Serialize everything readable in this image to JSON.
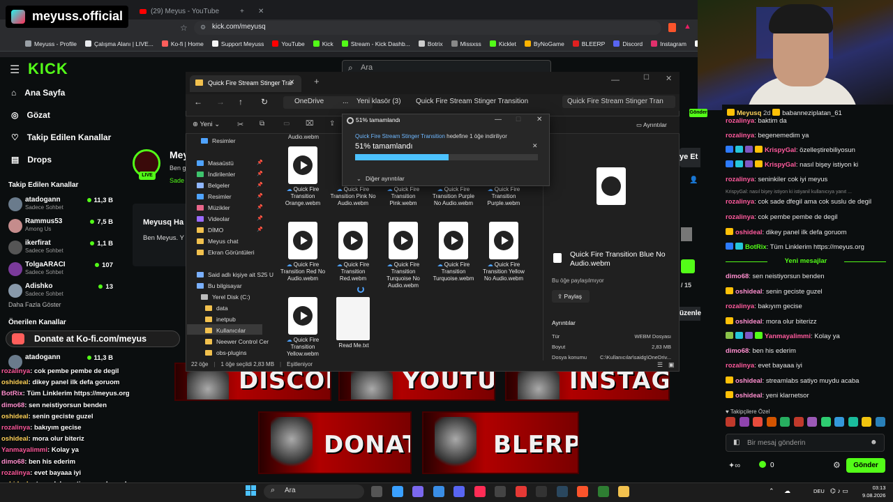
{
  "browser": {
    "tabs": [
      {
        "label": "Meyuss | Kick"
      },
      {
        "label": "(29) Meyus - YouTube"
      }
    ],
    "url": "kick.com/meyusq",
    "bookmarks": [
      {
        "label": "Meyuss - Profile",
        "color": "#9aa0a6"
      },
      {
        "label": "Çalışma Alanı | LIVE...",
        "color": "#e8eaed"
      },
      {
        "label": "Ko-fi | Home",
        "color": "#ff5e5b"
      },
      {
        "label": "Support Meyuss",
        "color": "#f5f5f5"
      },
      {
        "label": "YouTube",
        "color": "#ff0000"
      },
      {
        "label": "Kick",
        "color": "#53fc18"
      },
      {
        "label": "Stream - Kick Dashb...",
        "color": "#53fc18"
      },
      {
        "label": "Botrix",
        "color": "#cccccc"
      },
      {
        "label": "Missxss",
        "color": "#888888"
      },
      {
        "label": "Kicklet",
        "color": "#53fc18"
      },
      {
        "label": "ByNoGame",
        "color": "#ffb300"
      },
      {
        "label": "BLEERP",
        "color": "#e02020"
      },
      {
        "label": "Discord",
        "color": "#5865f2"
      },
      {
        "label": "Instagram",
        "color": "#e1306c"
      },
      {
        "label": "Tiktok",
        "color": "#ffffff"
      }
    ]
  },
  "overlay": {
    "tiktok_handle": "meyuss.official",
    "kofi_banner": "Donate at Ko-fi.com/meyus"
  },
  "kick": {
    "logo": "KICK",
    "search_placeholder": "Ara",
    "nav": [
      {
        "label": "Ana Sayfa"
      },
      {
        "label": "Gözat"
      },
      {
        "label": "Takip Edilen Kanallar"
      },
      {
        "label": "Drops"
      }
    ],
    "followed_header": "Takip Edilen Kanallar",
    "followed": [
      {
        "name": "atadogann",
        "category": "Sadece Sohbet",
        "viewers": "11,3 B",
        "color": "#6a7b8c"
      },
      {
        "name": "Rammus53",
        "category": "Among Us",
        "viewers": "7,5 B",
        "color": "#c58c8c"
      },
      {
        "name": "ikerfirat",
        "category": "Sadece Sohbet",
        "viewers": "1,1 B",
        "color": "#555"
      },
      {
        "name": "TolgaARACI",
        "category": "Sadece Sohbet",
        "viewers": "107",
        "color": "#7a3a9a"
      },
      {
        "name": "Adishko",
        "category": "Sadece Sohbet",
        "viewers": "13",
        "color": "#8899aa"
      }
    ],
    "show_more": "Daha Fazla Göster",
    "recommended_header": "Önerilen Kanallar",
    "channel_title_fragment": "Mey",
    "channel_sub_fragment": "Ben g",
    "channel_category_fragment": "Sade",
    "about_title_fragment": "Meyusq Ha",
    "about_text_fragment": "Ben Meyus. Y",
    "live_badge": "LIVE",
    "follow_fragment": "ye Et",
    "page_fragment": "/ 15",
    "edit_fragment": "üzenle",
    "banners": [
      "DISCORD",
      "YOUTUBE",
      "INSTAGRAM",
      "DONATE",
      "BLERP"
    ]
  },
  "overlay_chat": [
    {
      "user": "rozalinya",
      "text": "cok pembe pembe de degil",
      "cls": "u"
    },
    {
      "user": "oshideal",
      "text": "dikey panel ilk defa goruom",
      "cls": "u2"
    },
    {
      "user": "BotRix",
      "text": "Tüm Linklerim https://meyus.org",
      "cls": "u3"
    },
    {
      "user": "dimo68",
      "text": "sen neistiyorsun benden",
      "cls": "u3"
    },
    {
      "user": "oshideal",
      "text": "senin geciste guzel",
      "cls": "u2"
    },
    {
      "user": "rozalinya",
      "text": "bakıyım gecise",
      "cls": "u"
    },
    {
      "user": "oshideal",
      "text": "mora olur biteriz",
      "cls": "u2"
    },
    {
      "user": "Yanmayalimmi",
      "text": "Kolay ya",
      "cls": "u"
    },
    {
      "user": "dimo68",
      "text": "ben his ederim",
      "cls": "u3"
    },
    {
      "user": "rozalinya",
      "text": "evet bayaaa iyi",
      "cls": "u"
    },
    {
      "user": "oshideal",
      "text": "streamlabs satiyo muydu acaba",
      "cls": "u2"
    },
    {
      "user": "oshideal",
      "text": "yeni klarnetsor",
      "cls": "u2"
    }
  ],
  "explorer": {
    "tab_title": "Quick Fire Stream Stinger Trar",
    "breadcrumbs": [
      "OneDrive",
      "...",
      "Yeni klasör (3)",
      "Quick Fire Stream Stinger Transition"
    ],
    "search_placeholder": "Quick Fire Stream Stinger Tran",
    "new_button": "Yeni",
    "details_button": "Ayrıntılar",
    "tree": [
      {
        "label": "Resimler",
        "color": "#4fa3ff"
      },
      {
        "label": "Masaüstü",
        "color": "#4fa3ff"
      },
      {
        "label": "İndirilenler",
        "color": "#3ec46d"
      },
      {
        "label": "Belgeler",
        "color": "#8fb6ff"
      },
      {
        "label": "Resimler",
        "color": "#4fa3ff"
      },
      {
        "label": "Müzikler",
        "color": "#e9668a"
      },
      {
        "label": "Videolar",
        "color": "#9b6bff"
      },
      {
        "label": "DİMO",
        "color": "#f2c14e"
      },
      {
        "label": "Meyus chat",
        "color": "#f2c14e"
      },
      {
        "label": "Ekran Görüntüleri",
        "color": "#f2c14e"
      },
      {
        "label": "Said adlı kişiye ait S25 U",
        "color": "#7ab0ff"
      },
      {
        "label": "Bu bilgisayar",
        "color": "#7ab0ff"
      },
      {
        "label": "Yerel Disk (C:)",
        "color": "#bbbbbb"
      },
      {
        "label": "data",
        "color": "#f2c14e"
      },
      {
        "label": "inetpub",
        "color": "#f2c14e"
      },
      {
        "label": "Kullanıcılar",
        "color": "#f2c14e"
      },
      {
        "label": "Neewer Control Cer",
        "color": "#f2c14e"
      },
      {
        "label": "obs-plugins",
        "color": "#f2c14e"
      }
    ],
    "files_row0": "Audio.webm",
    "files": [
      {
        "name": "Quick Fire Transition Orange.webm"
      },
      {
        "name": "Quick Fire Transition Pink No Audio.webm"
      },
      {
        "name": "Quick Fire Transition Pink.webm"
      },
      {
        "name": "Quick Fire Transition Purple No Audio.webm"
      },
      {
        "name": "Quick Fire Transition Purple.webm"
      },
      {
        "name": "Quick Fire Transition Red No Audio.webm"
      },
      {
        "name": "Quick Fire Transition Red.webm"
      },
      {
        "name": "Quick Fire Transition Turquoise No Audio.webm"
      },
      {
        "name": "Quick Fire Transition Turquoise.webm"
      },
      {
        "name": "Quick Fire Transition Yellow No Audio.webm"
      },
      {
        "name": "Quick Fire Transition Yellow.webm"
      },
      {
        "name": "Read Me.txt"
      }
    ],
    "preview": {
      "title": "Quick Fire Transition Blue No Audio.webm",
      "sharing": "Bu öğe paylaşılmıyor",
      "share_button": "Paylaş",
      "details_header": "Ayrıntılar",
      "rows": [
        {
          "k": "Tür",
          "v": "WEBM Dosyası"
        },
        {
          "k": "Boyut",
          "v": "2,83 MB"
        },
        {
          "k": "Dosya konumu",
          "v": "C:\\Kullanıcılar\\saidg\\OneDriv..."
        }
      ]
    },
    "status": {
      "count": "22 öğe",
      "selected": "1 öğe seçildi  2,83 MB",
      "sync": "Eşitleniyor"
    }
  },
  "dialog": {
    "title": "51%  tamamlandı",
    "desc_link": "Quick Fire Stream Stinger Transition",
    "desc_rest": " hedefine 1 öğe indiriliyor",
    "pct_label": "51%  tamamlandı",
    "progress": 0.51,
    "more": "Diğer ayrıntılar"
  },
  "chat": {
    "header_user": "Meyusq",
    "header_rest": "babanneziplatan_61",
    "follow_btn": "Gönder",
    "lines": [
      {
        "user": "rozalinya",
        "text": "baktim da",
        "color": "#ff5a9d",
        "badges": []
      },
      {
        "user": "rozalinya",
        "text": "begenemedim ya",
        "color": "#ff5a9d",
        "badges": []
      },
      {
        "user": "KrispyGal",
        "text": "özelleştirebiliyosun",
        "color": "#ff5a9d",
        "badges": [
          "#2d7bff",
          "#26c6da",
          "#7e57c2",
          "#ffc107"
        ]
      },
      {
        "user": "KrispyGal",
        "text": "nasıl bişey istiyon ki",
        "color": "#ff5a9d",
        "badges": [
          "#2d7bff",
          "#26c6da",
          "#7e57c2",
          "#ffc107"
        ]
      },
      {
        "user": "rozalinya",
        "text": "seninkiler cok iyi meyus",
        "color": "#ff5a9d",
        "badges": []
      },
      {
        "user": "rozalinya",
        "text": "cok sade dfegil ama cok suslu de degil",
        "color": "#ff5a9d",
        "badges": []
      },
      {
        "user": "rozalinya",
        "text": "cok pembe pembe de degil",
        "color": "#ff5a9d",
        "badges": []
      },
      {
        "user": "oshideal",
        "text": "dikey panel ilk defa goruom",
        "color": "#ff5a9d",
        "badges": [
          "#ffc107"
        ]
      },
      {
        "user": "BotRix",
        "text": "Tüm Linklerim https://meyus.org",
        "color": "#53fc18",
        "badges": [
          "#2d7bff",
          "#26c6da"
        ]
      }
    ],
    "reply_hint": "KrispyGal: nasıl bişey istiyon ki istiyanil kullanıcıya yanıt ...",
    "new_messages": "Yeni mesajlar",
    "new_lines": [
      {
        "user": "dimo68",
        "text": "sen neistiyorsun benden",
        "color": "#ff8fcf",
        "badges": []
      },
      {
        "user": "oshideal",
        "text": "senin geciste guzel",
        "color": "#ff8fcf",
        "badges": [
          "#ffc107"
        ]
      },
      {
        "user": "rozalinya",
        "text": "bakıyım gecise",
        "color": "#ff5a9d",
        "badges": []
      },
      {
        "user": "oshideal",
        "text": "mora olur biterizz",
        "color": "#ff8fcf",
        "badges": [
          "#ffc107"
        ]
      },
      {
        "user": "Yanmayalimmi",
        "text": "Kolay ya",
        "color": "#ff5a9d",
        "badges": [
          "#8bc34a",
          "#26c6da",
          "#7e57c2",
          "#53fc18"
        ]
      },
      {
        "user": "dimo68",
        "text": "ben his ederim",
        "color": "#ff8fcf",
        "badges": []
      },
      {
        "user": "rozalinya",
        "text": "evet bayaaa iyi",
        "color": "#ff5a9d",
        "badges": []
      },
      {
        "user": "oshideal",
        "text": "streamlabs satiyo muydu acaba",
        "color": "#ff8fcf",
        "badges": [
          "#ffc107"
        ]
      },
      {
        "user": "oshideal",
        "text": "yeni klarnetsor",
        "color": "#ff8fcf",
        "badges": [
          "#ffc107"
        ]
      }
    ],
    "emote_header": "Takipçilere Özel",
    "input_placeholder": "Bir mesaj gönderin",
    "points": "0",
    "send": "Gönder"
  },
  "taskbar": {
    "search": "Ara",
    "lang": "DEU",
    "time": "03:13",
    "date": "9.08.2026"
  }
}
